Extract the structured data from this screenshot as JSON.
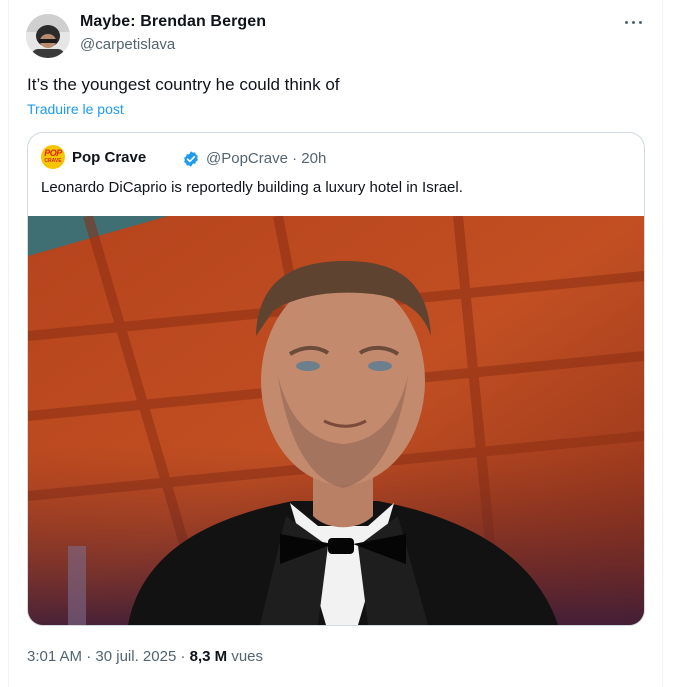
{
  "tweet": {
    "author_name": "Maybe: Brendan Bergen",
    "author_handle": "@carpetislava",
    "text": "It’s the youngest country he could think of",
    "translate_label": "Traduire le post",
    "time": "3:01 AM",
    "date": "30 juil. 2025",
    "views_count": "8,3 M",
    "views_label": "vues"
  },
  "quote": {
    "avatar_text": "POP",
    "avatar_subtext": "CRAVE",
    "author_name": "Pop Crave",
    "verified": true,
    "handle_time": "@PopCrave · 20h",
    "text": "Leonardo DiCaprio is reportedly building a luxury hotel in Israel."
  },
  "colors": {
    "link": "#1d9bf0",
    "secondary_text": "#536471",
    "verified_badge": "#1d9bf0",
    "border": "#cfd9de"
  },
  "icons": {
    "more": "more-dots-icon",
    "verified": "verified-badge-icon"
  }
}
